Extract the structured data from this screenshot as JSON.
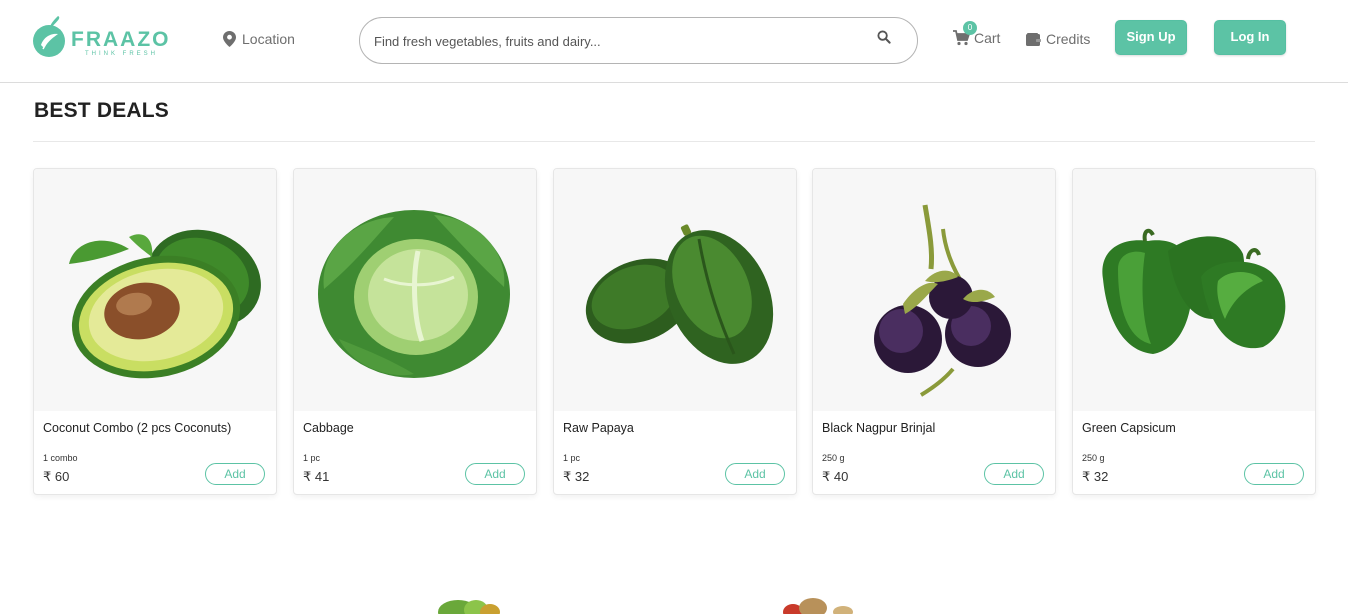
{
  "header": {
    "logo_text": "FRAAZO",
    "logo_tagline": "THINK FRESH",
    "location_label": "Location",
    "search_placeholder": "Find fresh vegetables, fruits and dairy...",
    "cart_label": "Cart",
    "cart_count": "0",
    "credits_label": "Credits",
    "signup_label": "Sign Up",
    "login_label": "Log In"
  },
  "section": {
    "title": "BEST DEALS"
  },
  "products": [
    {
      "name": "Coconut Combo (2 pcs Coconuts)",
      "qty": "1 combo",
      "price": "₹ 60",
      "add_label": "Add",
      "image_icon": "avocado-image"
    },
    {
      "name": "Cabbage",
      "qty": "1 pc",
      "price": "₹ 41",
      "add_label": "Add",
      "image_icon": "cabbage-image"
    },
    {
      "name": "Raw Papaya",
      "qty": "1 pc",
      "price": "₹ 32",
      "add_label": "Add",
      "image_icon": "papaya-image"
    },
    {
      "name": "Black Nagpur Brinjal",
      "qty": "250 g",
      "price": "₹ 40",
      "add_label": "Add",
      "image_icon": "brinjal-image"
    },
    {
      "name": "Green Capsicum",
      "qty": "250 g",
      "price": "₹ 32",
      "add_label": "Add",
      "image_icon": "capsicum-image"
    }
  ],
  "colors": {
    "accent": "#5cc3a5",
    "text_muted": "#6e6e6e"
  }
}
